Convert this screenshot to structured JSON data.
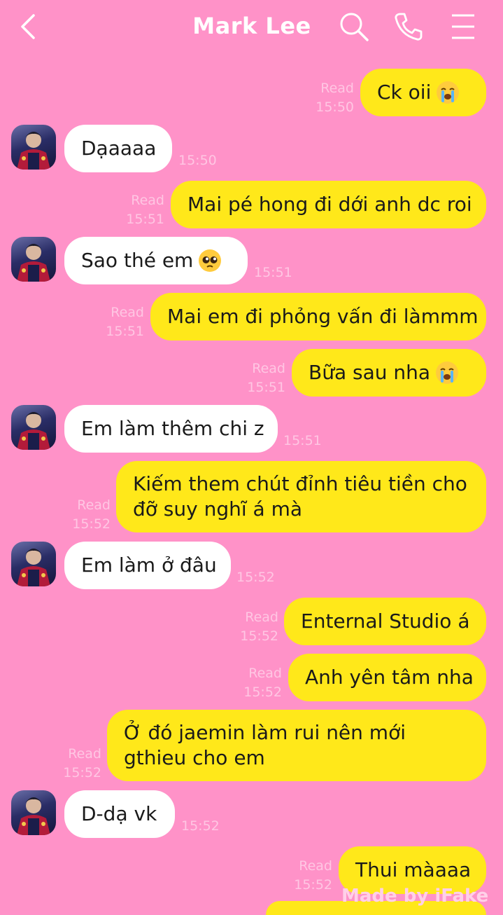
{
  "header": {
    "title": "Mark Lee",
    "icons": [
      "back-arrow-icon",
      "search-icon",
      "phone-icon",
      "menu-icon"
    ]
  },
  "colors": {
    "background": "#FF92C8",
    "sent_bubble": "#FFE81A",
    "received_bubble": "#FFFFFF",
    "meta_text": "#FFC6E3"
  },
  "messages": [
    {
      "dir": "sent",
      "text": "Ck oii",
      "emoji": "loudly-crying-face-emoji",
      "read": "Read",
      "time": "15:50"
    },
    {
      "dir": "recv",
      "text": "Dạaaaa",
      "time": "15:50"
    },
    {
      "dir": "sent",
      "text": "Mai pé hong đi dới anh dc roi",
      "read": "Read",
      "time": "15:51"
    },
    {
      "dir": "recv",
      "text": "Sao thé em",
      "emoji": "pleading-face-emoji",
      "time": "15:51"
    },
    {
      "dir": "sent",
      "text": "Mai em đi phỏng vấn đi làmmm",
      "read": "Read",
      "time": "15:51"
    },
    {
      "dir": "sent",
      "text": "Bữa sau nha",
      "emoji": "loudly-crying-face-emoji",
      "read": "Read",
      "time": "15:51"
    },
    {
      "dir": "recv",
      "text": "Em làm thêm chi z",
      "time": "15:51"
    },
    {
      "dir": "sent",
      "text": "Kiếm them chút đỉnh tiêu tiền cho đỡ suy nghĩ á mà",
      "read": "Read",
      "time": "15:52"
    },
    {
      "dir": "recv",
      "text": "Em làm ở đâu",
      "time": "15:52"
    },
    {
      "dir": "sent",
      "text": "Enternal Studio á",
      "read": "Read",
      "time": "15:52"
    },
    {
      "dir": "sent",
      "text": "Anh yên tâm nha",
      "read": "Read",
      "time": "15:52"
    },
    {
      "dir": "sent",
      "text": "Ở đó jaemin làm rui nên mới gthieu cho em",
      "read": "Read",
      "time": "15:52"
    },
    {
      "dir": "recv",
      "text": "D-dạ vk",
      "time": "15:52"
    },
    {
      "dir": "sent",
      "text": "Thui màaaa",
      "read": "Read",
      "time": "15:52"
    }
  ],
  "watermark": "Made by iFake"
}
